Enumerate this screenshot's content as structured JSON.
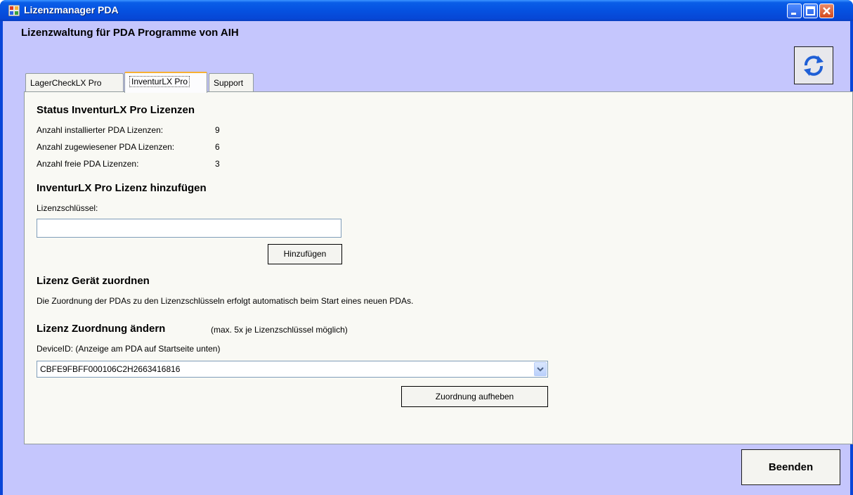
{
  "window": {
    "title": "Lizenzmanager PDA",
    "heading": "Lizenzwaltung für PDA Programme von AIH"
  },
  "tabs": [
    {
      "label": "LagerCheckLX Pro",
      "selected": false
    },
    {
      "label": "InventurLX Pro",
      "selected": true
    },
    {
      "label": "Support",
      "selected": false
    }
  ],
  "status": {
    "title": "Status InventurLX Pro Lizenzen",
    "rows": [
      {
        "label": "Anzahl installierter PDA Lizenzen:",
        "value": "9"
      },
      {
        "label": "Anzahl zugewiesener PDA Lizenzen:",
        "value": "6"
      },
      {
        "label": "Anzahl freie PDA Lizenzen:",
        "value": "3"
      }
    ]
  },
  "add_license": {
    "title": "InventurLX Pro Lizenz hinzufügen",
    "key_label": "Lizenzschlüssel:",
    "key_value": "",
    "add_button": "Hinzufügen"
  },
  "assign": {
    "title": "Lizenz Gerät zuordnen",
    "text": "Die Zuordnung der PDAs zu den Lizenzschlüsseln erfolgt automatisch beim Start eines neuen PDAs."
  },
  "change": {
    "title": "Lizenz Zuordnung ändern",
    "note": "(max. 5x je Lizenzschlüssel möglich)",
    "device_label": "DeviceID: (Anzeige am PDA auf Startseite unten)",
    "device_value": "CBFE9FBFF000106C2H2663416816",
    "remove_button": "Zuordnung aufheben"
  },
  "footer": {
    "exit_button": "Beenden"
  },
  "icons": {
    "refresh": "refresh-icon",
    "app": "app-icon"
  }
}
